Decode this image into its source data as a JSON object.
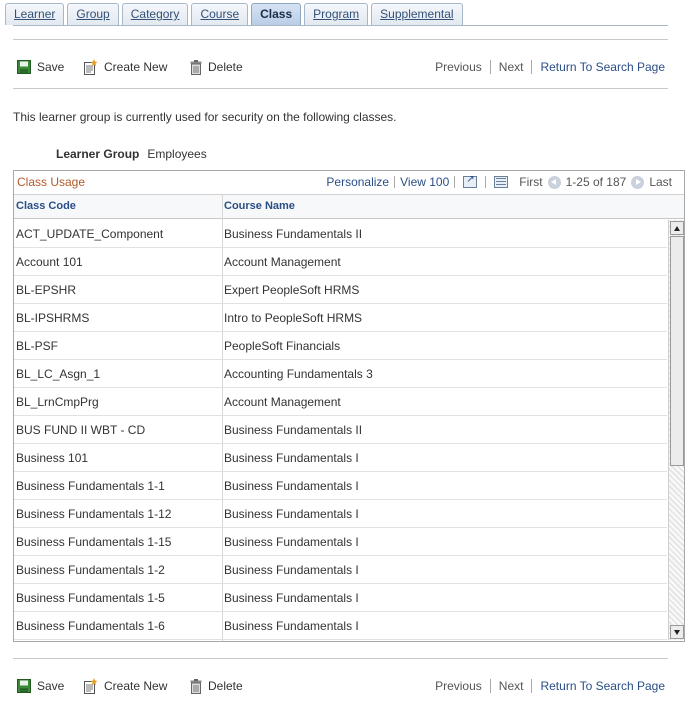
{
  "tabs": [
    {
      "label": "Learner",
      "active": false
    },
    {
      "label": "Group",
      "active": false
    },
    {
      "label": "Category",
      "active": false
    },
    {
      "label": "Course",
      "active": false
    },
    {
      "label": "Class",
      "active": true
    },
    {
      "label": "Program",
      "active": false
    },
    {
      "label": "Supplemental",
      "active": false
    }
  ],
  "toolbar": {
    "save_label": "Save",
    "create_new_label": "Create New",
    "delete_label": "Delete",
    "previous_label": "Previous",
    "next_label": "Next",
    "return_label": "Return To Search Page"
  },
  "message": "This learner group is currently used for security on the following classes.",
  "learner_group": {
    "label": "Learner Group",
    "value": "Employees"
  },
  "grid": {
    "title": "Class Usage",
    "personalize": "Personalize",
    "view_all": "View 100",
    "first": "First",
    "range": "1-25 of 187",
    "last": "Last",
    "columns": [
      "Class Code",
      "Course Name"
    ],
    "rows": [
      [
        "ACT_UPDATE_Component",
        "Business Fundamentals II"
      ],
      [
        "Account 101",
        "Account Management"
      ],
      [
        "BL-EPSHR",
        "Expert PeopleSoft HRMS"
      ],
      [
        "BL-IPSHRMS",
        "Intro to PeopleSoft HRMS"
      ],
      [
        "BL-PSF",
        "PeopleSoft Financials"
      ],
      [
        "BL_LC_Asgn_1",
        "Accounting Fundamentals 3"
      ],
      [
        "BL_LrnCmpPrg",
        "Account Management"
      ],
      [
        "BUS FUND II WBT - CD",
        "Business Fundamentals II"
      ],
      [
        "Business 101",
        "Business Fundamentals I"
      ],
      [
        "Business Fundamentals 1-1",
        "Business Fundamentals I"
      ],
      [
        "Business Fundamentals 1-12",
        "Business Fundamentals I"
      ],
      [
        "Business Fundamentals 1-15",
        "Business Fundamentals I"
      ],
      [
        "Business Fundamentals 1-2",
        "Business Fundamentals I"
      ],
      [
        "Business Fundamentals 1-5",
        "Business Fundamentals I"
      ],
      [
        "Business Fundamentals 1-6",
        "Business Fundamentals I"
      ]
    ]
  },
  "colors": {
    "link": "#2a4e86",
    "grid_title": "#b35a2a",
    "save_icon": "#3a8a3a"
  },
  "icons": {
    "save": "save-icon",
    "create_new": "create-new-icon",
    "delete": "trash-icon"
  }
}
